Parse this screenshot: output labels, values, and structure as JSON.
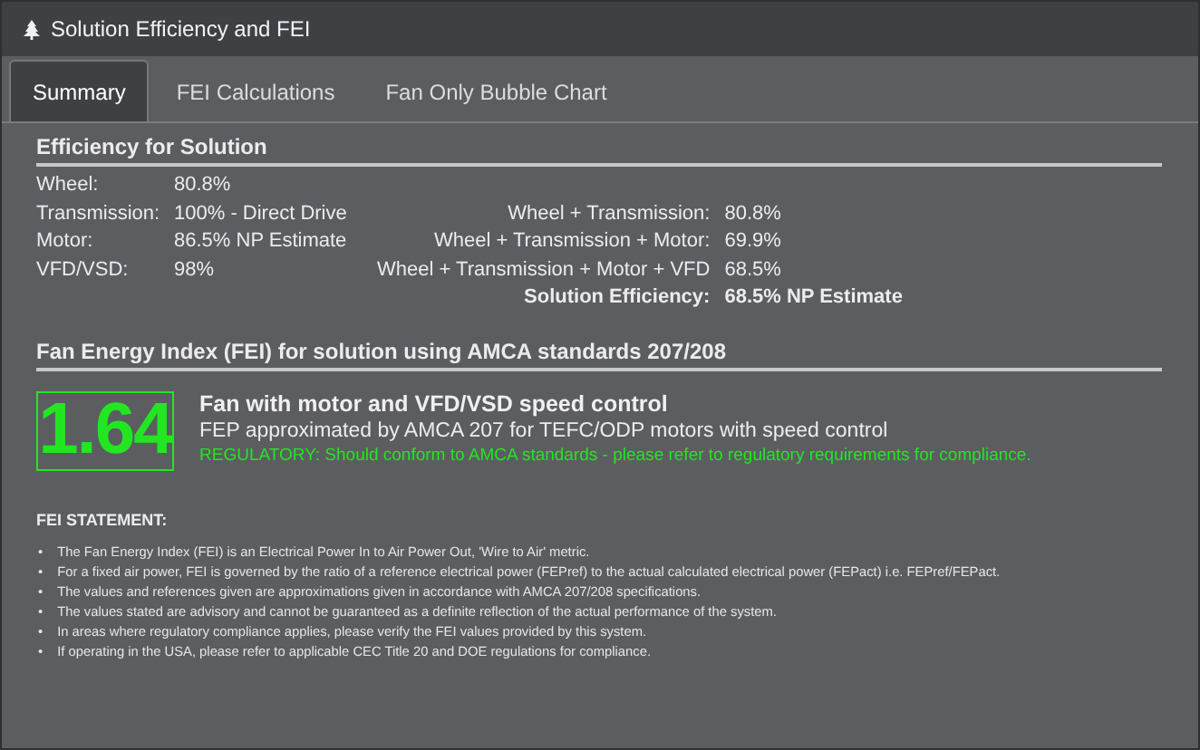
{
  "window": {
    "title": "Solution Efficiency and FEI"
  },
  "tabs": [
    {
      "label": "Summary",
      "selected": true
    },
    {
      "label": "FEI Calculations",
      "selected": false
    },
    {
      "label": "Fan Only Bubble Chart",
      "selected": false
    }
  ],
  "efficiency": {
    "heading": "Efficiency for Solution",
    "rows": [
      {
        "left": {
          "label": "Wheel:",
          "value": "80.8%"
        }
      },
      {
        "left": {
          "label": "Transmission:",
          "value": "100% - Direct Drive"
        },
        "right": {
          "label": "Wheel + Transmission:",
          "value": "80.8%",
          "kind": "normal"
        }
      },
      {
        "left": {
          "label": "Motor:",
          "value": "86.5% NP Estimate"
        },
        "right": {
          "label": "Wheel + Transmission + Motor:",
          "value": "69.9%",
          "kind": "normal"
        }
      },
      {
        "left": {
          "label": "VFD/VSD:",
          "value": "98%"
        },
        "right": {
          "label": "Wheel + Transmission + Motor + VFD",
          "value": "68.5%",
          "kind": "normal"
        }
      },
      {
        "right": {
          "label": "Solution Efficiency:",
          "value": "68.5% NP Estimate",
          "kind": "total"
        }
      }
    ]
  },
  "fei": {
    "heading": "Fan Energy Index (FEI) for solution using AMCA standards 207/208",
    "value": "1.64",
    "color": "#22e622",
    "title": "Fan with motor and VFD/VSD speed control",
    "description": "FEP approximated by AMCA 207 for TEFC/ODP motors with speed control",
    "regulatory": "REGULATORY: Should conform to AMCA standards - please refer to regulatory requirements for compliance."
  },
  "statement": {
    "heading": "FEI STATEMENT:",
    "items": [
      {
        "marker": "•",
        "text": "The Fan Energy Index (FEI) is an Electrical Power In to Air Power Out, 'Wire to Air' metric."
      },
      {
        "marker": "•",
        "text": "For a fixed air power, FEI is governed by the ratio of a reference electrical power (FEPref) to the actual calculated electrical power (FEPact) i.e. FEPref/FEPact."
      },
      {
        "marker": "•",
        "text": "The values and references given are approximations given in accordance with AMCA 207/208 specifications."
      },
      {
        "marker": "•",
        "text": "The values stated are advisory and cannot be guaranteed as a definite reflection of the actual performance of the system."
      },
      {
        "marker": "•",
        "text": "In areas where regulatory compliance applies, please verify the FEI values provided by this system."
      },
      {
        "marker": "•",
        "text": "If operating in the USA, please refer to applicable CEC Title 20 and DOE regulations for compliance."
      }
    ]
  }
}
